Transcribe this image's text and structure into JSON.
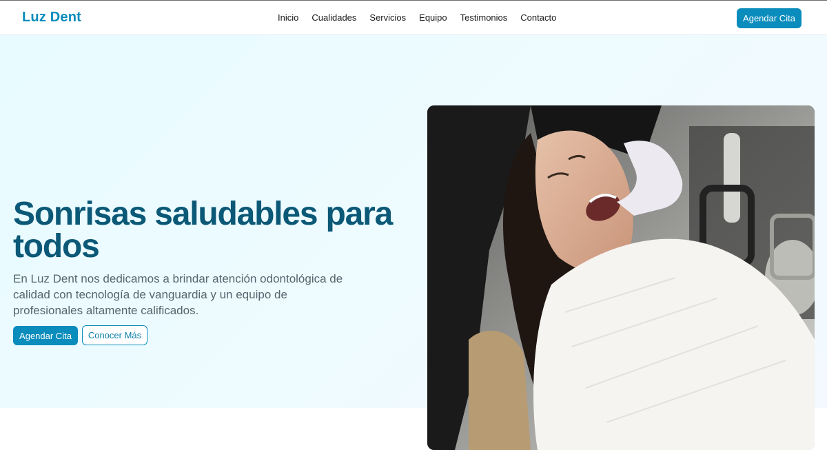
{
  "brand": {
    "name": "Luz Dent"
  },
  "nav": {
    "items": [
      {
        "label": "Inicio"
      },
      {
        "label": "Cualidades"
      },
      {
        "label": "Servicios"
      },
      {
        "label": "Equipo"
      },
      {
        "label": "Testimonios"
      },
      {
        "label": "Contacto"
      }
    ],
    "cta_label": "Agendar Cita"
  },
  "hero": {
    "title": "Sonrisas saludables para todos",
    "description": "En Luz Dent nos dedicamos a brindar atención odontológica de calidad con tecnología de vanguardia y un equipo de profesionales altamente calificados.",
    "primary_label": "Agendar Cita",
    "secondary_label": "Conocer Más",
    "image_icon": "dental-patient-photo"
  },
  "colors": {
    "accent": "#0a8cbc",
    "title": "#0b5877",
    "text": "#56656e",
    "hero_bg": "#e9fbff"
  }
}
